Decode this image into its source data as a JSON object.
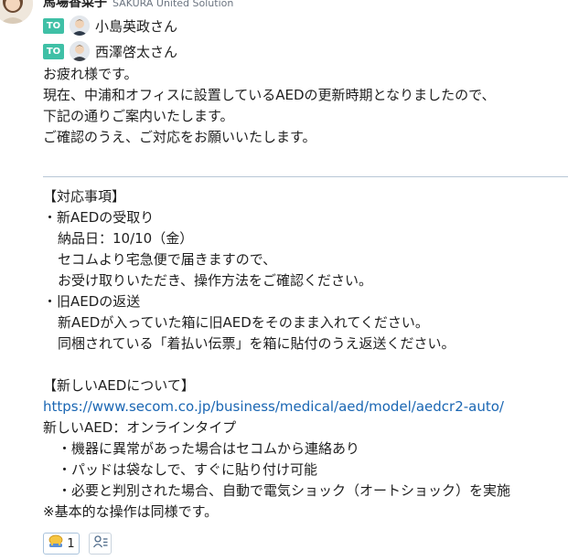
{
  "sender": {
    "name": "馬場香菜子",
    "org": "SAKURA United Solution"
  },
  "to": [
    {
      "badge": "TO",
      "name": "小島英政さん"
    },
    {
      "badge": "TO",
      "name": "西澤啓太さん"
    }
  ],
  "body_intro": [
    "お疲れ様です。",
    "現在、中浦和オフィスに設置しているAEDの更新時期となりましたので、",
    "下記の通りご案内いたします。",
    "ご確認のうえ、ご対応をお願いいたします。"
  ],
  "section1": {
    "heading": "【対応事項】",
    "item1_title": "・新AEDの受取り",
    "item1_lines": [
      "納品日：10/10（金）",
      "セコムより宅急便で届きますので、",
      "お受け取りいただき、操作方法をご確認ください。"
    ],
    "item2_title": "・旧AEDの返送",
    "item2_lines": [
      "新AEDが入っていた箱に旧AEDをそのまま入れてください。",
      "同梱されている「着払い伝票」を箱に貼付のうえ返送ください。"
    ]
  },
  "section2": {
    "heading": "【新しいAEDについて】",
    "link": "https://www.secom.co.jp/business/medical/aed/model/aedcr2-auto/",
    "type_line": "新しいAED：オンラインタイプ",
    "features": [
      "・機器に異常があった場合はセコムから連絡あり",
      "・パッドは袋なしで、すぐに貼り付け可能",
      "・必要と判別された場合、自動で電気ショック（オートショック）を実施"
    ],
    "note": "※基本的な操作は同様です。"
  },
  "reaction": {
    "icon": "bowing-emoji-icon",
    "count": "1"
  },
  "colors": {
    "to_badge": "#3fc0a6",
    "link": "#1a66b3",
    "divider": "#b7c7d6"
  }
}
